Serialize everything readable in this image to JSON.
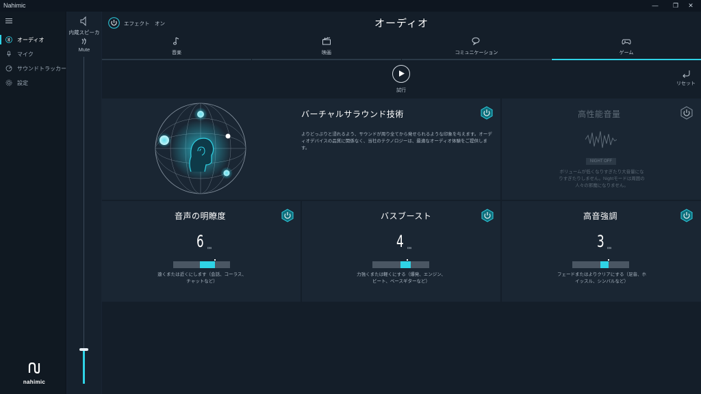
{
  "window": {
    "title": "Nahimic",
    "minimize": "—",
    "restore": "❐",
    "close": "✕"
  },
  "sidebar": {
    "items": [
      {
        "label": "オーディオ",
        "icon": "audio-wave-icon",
        "active": true
      },
      {
        "label": "マイク",
        "icon": "microphone-icon",
        "active": false
      },
      {
        "label": "サウンドトラッカー",
        "icon": "sound-tracker-icon",
        "active": false
      },
      {
        "label": "設定",
        "icon": "gear-icon",
        "active": false
      }
    ],
    "brand": "nahimic"
  },
  "device": {
    "name": "内蔵スピーカー",
    "mute_label": "Mute",
    "volume": 0.1
  },
  "header": {
    "effect_label": "エフェクト　オン",
    "title": "オーディオ"
  },
  "tabs": [
    {
      "label": "音楽",
      "icon": "music-note-icon",
      "active": false
    },
    {
      "label": "映画",
      "icon": "clapperboard-icon",
      "active": false
    },
    {
      "label": "コミュニケーション",
      "icon": "chat-bubbles-icon",
      "active": false
    },
    {
      "label": "ゲーム",
      "icon": "gamepad-icon",
      "active": true
    }
  ],
  "toolbar": {
    "play_label": "試行",
    "reset_label": "リセット"
  },
  "virtual_surround": {
    "title": "バーチャルサラウンド技術",
    "description": "よりどっぷりと浸れるよう、サウンドが周り全てから発せられるような印象を与えます。オーディオデバイスの品質に関係なく、当社のテクノロジーは、最適なオーディオ体験をご提供します。"
  },
  "volume_boost": {
    "title": "高性能音量",
    "night_button": "NIGHT OFF",
    "description": "ボリュームが低くなりすぎたり大音量になりすぎたりしません。Nightモードは周囲の人々の邪魔になりません。"
  },
  "voice_clarity": {
    "title": "音声の明瞭度",
    "value": "6",
    "unit": "DB",
    "level": 0.6,
    "description": "遠くまたは近くにします（会話、コーラス、チャットなど）"
  },
  "bass_boost": {
    "title": "バスブースト",
    "value": "4",
    "unit": "DB",
    "level": 0.6,
    "description": "力強くまたは軽くにする（爆発、エンジン、ビート、ベースギターなど）"
  },
  "treble": {
    "title": "高音強調",
    "value": "3",
    "unit": "DB",
    "level": 0.6,
    "description": "フェードまたはよりクリアにする（足音、ホイッスル、シンバルなど）"
  },
  "colors": {
    "accent": "#2fd3e6",
    "background": "#141e29",
    "panel": "#1a2633",
    "sidebar": "#101922"
  }
}
